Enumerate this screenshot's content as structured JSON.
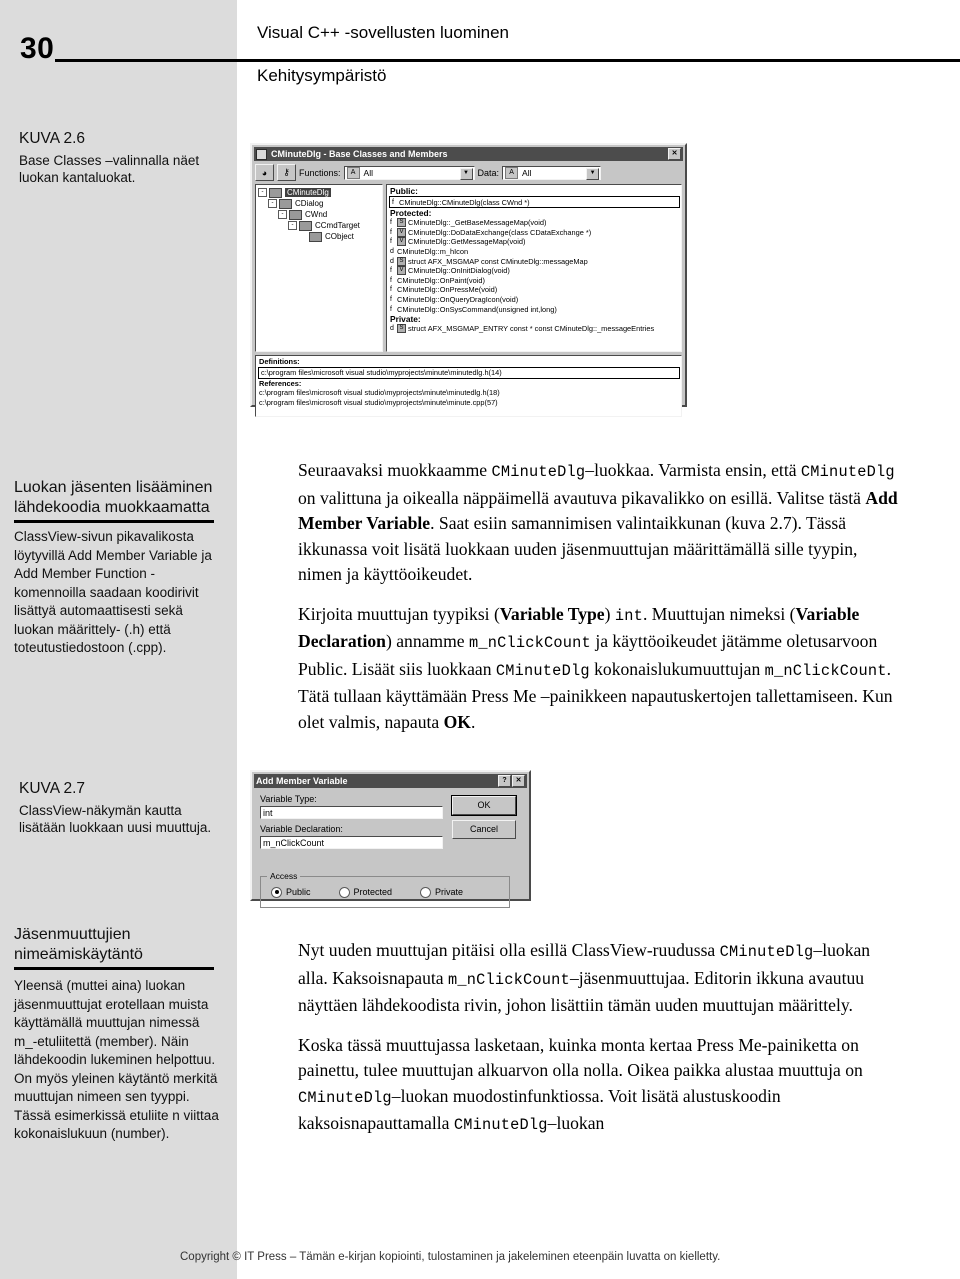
{
  "header": {
    "page_number": "30",
    "title": "Visual C++ -sovellusten luominen",
    "subtitle": "Kehitysympäristö"
  },
  "figure_26_caption": {
    "label": "KUVA 2.6",
    "text": "Base Classes –valinnalla näet luokan kantaluokat."
  },
  "figure_27_caption": {
    "label": "KUVA 2.7",
    "text": "ClassView-näkymän kautta lisätään luokkaan uusi muuttuja."
  },
  "sidebar_sections": [
    {
      "heading_line1": "Luokan jäsenten lisääminen",
      "heading_line2": "lähdekoodia muokkaamatta",
      "body": "ClassView-sivun pikavalikosta löytyvillä Add Member Variable ja Add Member Function - komennoilla saadaan koodirivit lisättyä automaattisesti sekä luokan määrittely- (.h) että toteutustiedostoon (.cpp)."
    },
    {
      "heading_line1": "Jäsenmuuttujien",
      "heading_line2": "nimeämiskäytäntö",
      "body": "Yleensä (muttei aina) luokan jäsenmuuttujat erotellaan muista käyttämällä muuttujan nimessä m_-etuliitettä (member). Näin lähdekoodin lukeminen helpottuu. On myös yleinen käytäntö merkitä muuttujan nimeen sen tyyppi. Tässä esimerkissä etuliite n viittaa kokonaislukuun (number)."
    }
  ],
  "body_paragraphs": {
    "p1": {
      "t1": "Seuraavaksi muokkaamme ",
      "c1": "CMinuteDlg",
      "t2": "–luokkaa. Varmista ensin, että ",
      "c2": "CMinuteDlg",
      "t3": " on valittuna ja oikealla näppäimellä avautuva pikavalikko on esillä. Valitse tästä ",
      "b1": "Add Member Variable",
      "t4": ". Saat esiin samannimisen valintaikkunan (kuva 2.7). Tässä ikkunassa voit lisätä luokkaan uuden jäsenmuuttujan määrittämällä sille tyypin, nimen ja käyttöoikeudet."
    },
    "p2": {
      "t1": "Kirjoita muuttujan tyypiksi (",
      "b1": "Variable Type",
      "t2": ") ",
      "c1": "int",
      "t3": ". Muuttujan nimeksi (",
      "b2": "Variable Declaration",
      "t4": ") annamme ",
      "c2": "m_nClickCount",
      "t5": " ja käyttöoikeudet jätämme oletusarvoon Public. Lisäät siis luokkaan ",
      "c3": "CMinuteDlg",
      "t6": " kokonaislukumuuttujan ",
      "c4": "m_nClickCount",
      "t7": ". Tätä tullaan käyttämään Press Me –painikkeen napautuskertojen tallettamiseen. Kun olet valmis, napauta ",
      "b3": "OK",
      "t8": "."
    },
    "p3": {
      "t1": "Nyt uuden muuttujan pitäisi olla esillä ClassView-ruudussa ",
      "c1": "CMinuteDlg",
      "t2": "–luokan alla. Kaksoisnapauta ",
      "c2": "m_nClickCount",
      "t3": "–jäsenmuuttujaa. Editorin ikkuna avautuu näyttäen lähdekoodista rivin, johon lisättiin tämän uuden muuttujan määrittely."
    },
    "p4": {
      "t1": "Koska tässä muuttujassa lasketaan, kuinka monta kertaa Press Me-painiketta on painettu, tulee muuttujan alkuarvon olla nolla. Oikea paikka alustaa muuttuja on ",
      "c1": "CMinuteDlg",
      "t2": "–luokan muodostinfunktiossa. Voit lisätä alustuskoodin kaksoisnapauttamalla ",
      "c2": "CMinuteDlg",
      "t3": "–luokan"
    }
  },
  "class_browser": {
    "title": "CMinuteDlg - Base Classes and Members",
    "close_label": "✕",
    "toolbar": {
      "functions_label": "Functions:",
      "functions_value": "All",
      "functions_badge": "A",
      "data_label": "Data:",
      "data_value": "All",
      "data_badge": "A"
    },
    "tree": [
      {
        "label": "CMinuteDlg",
        "depth": 0,
        "toggle": "-",
        "selected": true
      },
      {
        "label": "CDialog",
        "depth": 1,
        "toggle": "-",
        "selected": false
      },
      {
        "label": "CWnd",
        "depth": 2,
        "toggle": "-",
        "selected": false
      },
      {
        "label": "CCmdTarget",
        "depth": 3,
        "toggle": "-",
        "selected": false
      },
      {
        "label": "CObject",
        "depth": 4,
        "toggle": "",
        "selected": false
      }
    ],
    "sections": [
      {
        "header": "Public:",
        "rows": [
          {
            "kind": "f",
            "badge": "",
            "text": "CMinuteDlg::CMinuteDlg(class CWnd *)",
            "boxed": true
          }
        ]
      },
      {
        "header": "Protected:",
        "rows": [
          {
            "kind": "f",
            "badge": "S",
            "text": "CMinuteDlg::_GetBaseMessageMap(void)",
            "boxed": false
          },
          {
            "kind": "f",
            "badge": "V",
            "text": "CMinuteDlg::DoDataExchange(class CDataExchange *)",
            "boxed": false
          },
          {
            "kind": "f",
            "badge": "V",
            "text": "CMinuteDlg::GetMessageMap(void)",
            "boxed": false
          },
          {
            "kind": "d",
            "badge": "",
            "text": "CMinuteDlg::m_hIcon",
            "boxed": false
          },
          {
            "kind": "d",
            "badge": "S",
            "text": "struct AFX_MSGMAP const  CMinuteDlg::messageMap",
            "boxed": false
          },
          {
            "kind": "f",
            "badge": "V",
            "text": "CMinuteDlg::OnInitDialog(void)",
            "boxed": false
          },
          {
            "kind": "f",
            "badge": "",
            "text": "CMinuteDlg::OnPaint(void)",
            "boxed": false
          },
          {
            "kind": "f",
            "badge": "",
            "text": "CMinuteDlg::OnPressMe(void)",
            "boxed": false
          },
          {
            "kind": "f",
            "badge": "",
            "text": "CMinuteDlg::OnQueryDragIcon(void)",
            "boxed": false
          },
          {
            "kind": "f",
            "badge": "",
            "text": "CMinuteDlg::OnSysCommand(unsigned int,long)",
            "boxed": false
          }
        ]
      },
      {
        "header": "Private:",
        "rows": [
          {
            "kind": "d",
            "badge": "S",
            "text": "struct AFX_MSGMAP_ENTRY const * const CMinuteDlg::_messageEntries",
            "boxed": false
          }
        ]
      }
    ],
    "definitions": {
      "header": "Definitions:",
      "items": [
        "c:\\program files\\microsoft visual studio\\myprojects\\minute\\minutedlg.h(14)"
      ]
    },
    "references": {
      "header": "References:",
      "items": [
        "c:\\program files\\microsoft visual studio\\myprojects\\minute\\minutedlg.h(18)",
        "c:\\program files\\microsoft visual studio\\myprojects\\minute\\minute.cpp(57)"
      ]
    }
  },
  "add_member_variable": {
    "title": "Add Member Variable",
    "help_label": "?",
    "close_label": "✕",
    "variable_type_label": "Variable Type:",
    "variable_type_value": "int",
    "variable_declaration_label": "Variable Declaration:",
    "variable_declaration_value": "m_nClickCount",
    "ok_label": "OK",
    "cancel_label": "Cancel",
    "access_legend": "Access",
    "access_options": [
      {
        "label": "Public",
        "selected": true
      },
      {
        "label": "Protected",
        "selected": false
      },
      {
        "label": "Private",
        "selected": false
      }
    ]
  },
  "footer": {
    "copyright": "Copyright © IT Press – Tämän e-kirjan kopiointi, tulostaminen ja jakeleminen eteenpäin luvatta on kielletty."
  }
}
